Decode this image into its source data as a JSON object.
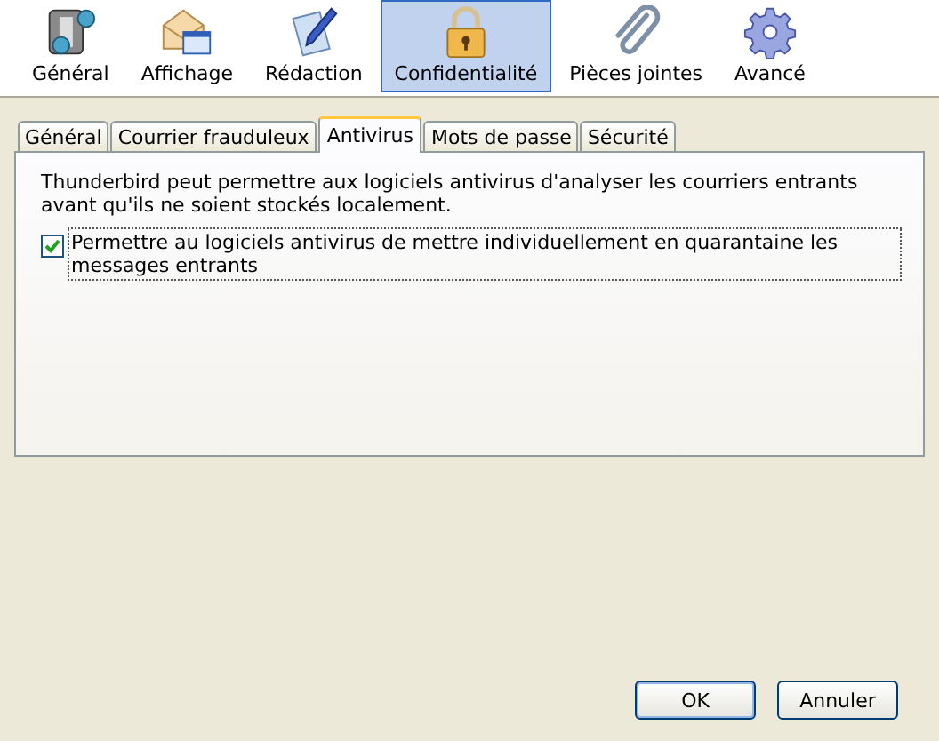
{
  "toolbar": [
    {
      "label": "Général",
      "selected": false
    },
    {
      "label": "Affichage",
      "selected": false
    },
    {
      "label": "Rédaction",
      "selected": false
    },
    {
      "label": "Confidentialité",
      "selected": true
    },
    {
      "label": "Pièces jointes",
      "selected": false
    },
    {
      "label": "Avancé",
      "selected": false
    }
  ],
  "tabs": [
    {
      "label": "Général",
      "selected": false
    },
    {
      "label": "Courrier frauduleux",
      "selected": false
    },
    {
      "label": "Antivirus",
      "selected": true
    },
    {
      "label": "Mots de passe",
      "selected": false
    },
    {
      "label": "Sécurité",
      "selected": false
    }
  ],
  "panel": {
    "description": "Thunderbird peut permettre aux logiciels antivirus d'analyser les courriers entrants avant qu'ils ne soient stockés localement.",
    "checkbox": {
      "label": "Permettre au logiciels antivirus de mettre individuellement en quarantaine les messages entrants",
      "checked": true
    }
  },
  "buttons": [
    "OK",
    "Annuler"
  ]
}
